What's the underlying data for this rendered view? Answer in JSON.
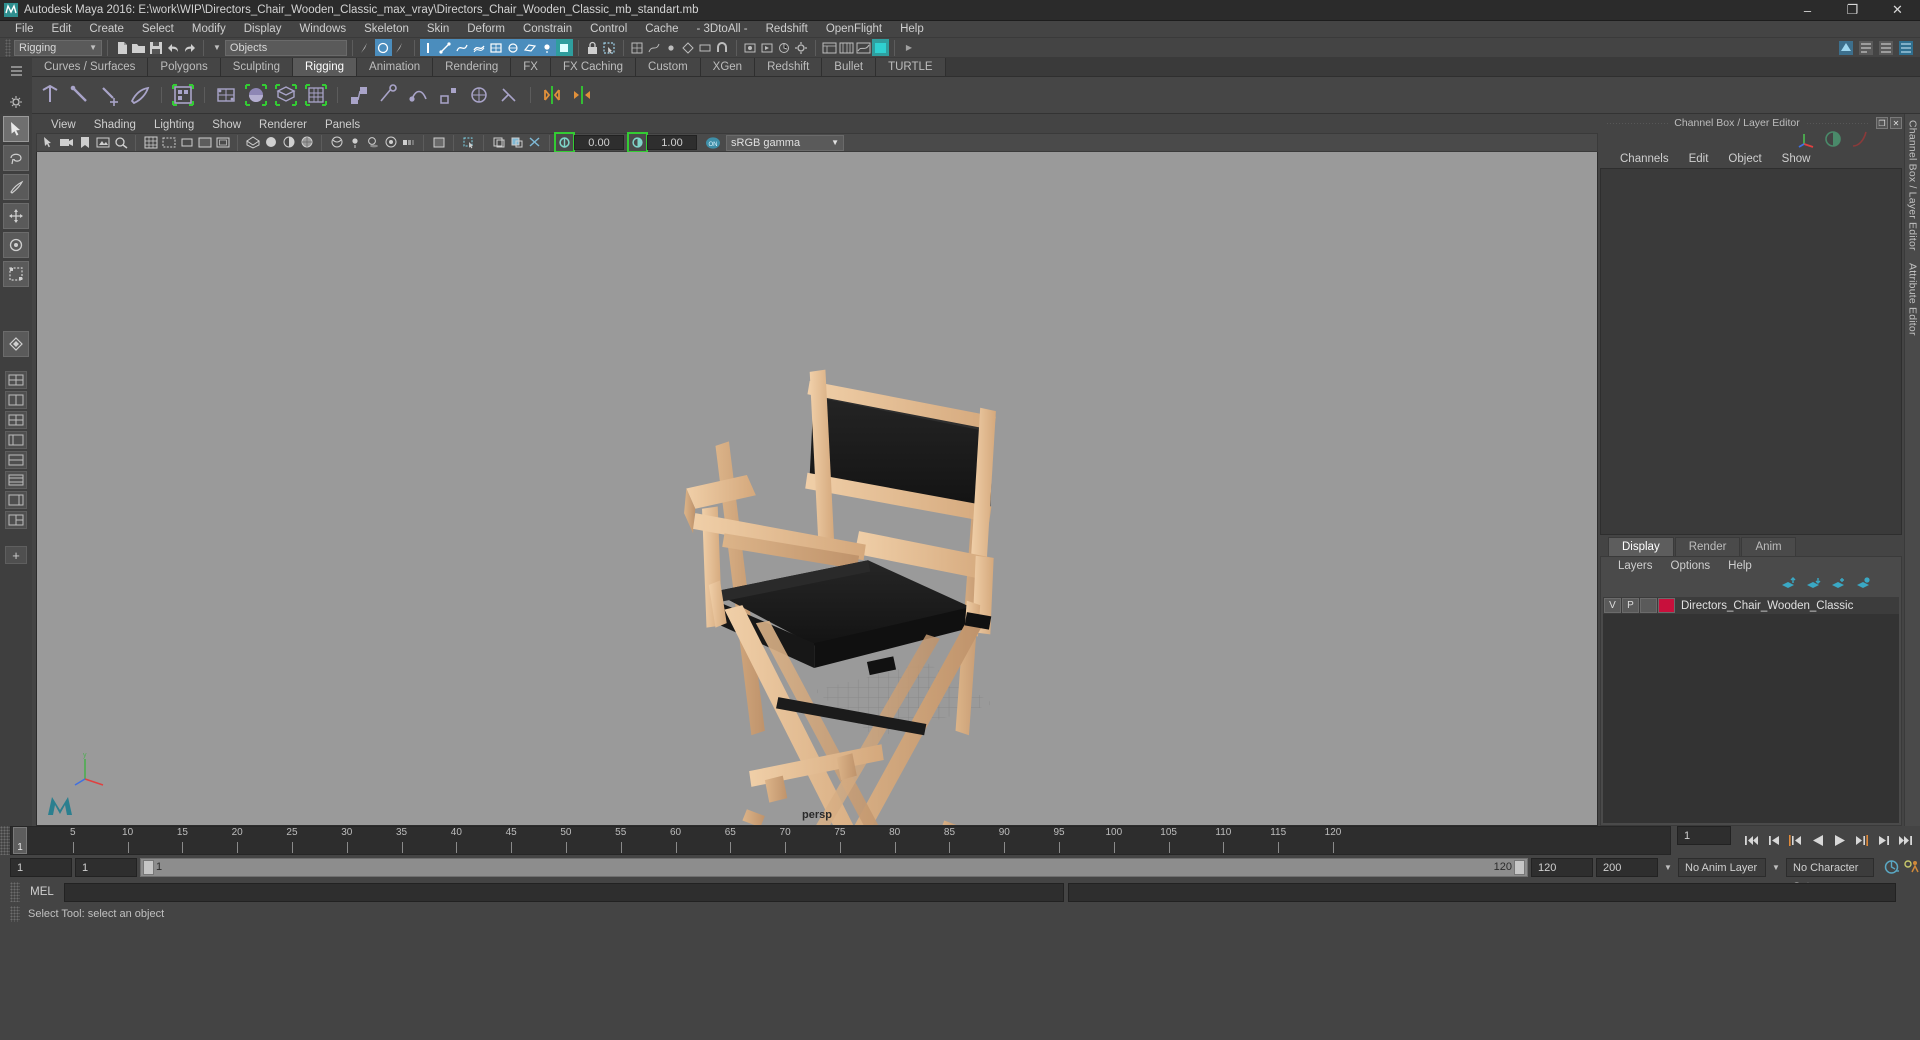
{
  "window": {
    "title": "Autodesk Maya 2016: E:\\work\\WIP\\Directors_Chair_Wooden_Classic_max_vray\\Directors_Chair_Wooden_Classic_mb_standart.mb",
    "minimize": "–",
    "maximize": "❐",
    "close": "✕"
  },
  "menubar": {
    "items": [
      "File",
      "Edit",
      "Create",
      "Select",
      "Modify",
      "Display",
      "Windows",
      "Skeleton",
      "Skin",
      "Deform",
      "Constrain",
      "Control",
      "Cache",
      "- 3DtoAll -",
      "Redshift",
      "OpenFlight",
      "Help"
    ]
  },
  "statusbar": {
    "menuset": "Rigging",
    "selection_mask": "Objects"
  },
  "shelf": {
    "tabs": [
      "Curves / Surfaces",
      "Polygons",
      "Sculpting",
      "Rigging",
      "Animation",
      "Rendering",
      "FX",
      "FX Caching",
      "Custom",
      "XGen",
      "Redshift",
      "Bullet",
      "TURTLE"
    ],
    "active_tab": "Rigging"
  },
  "viewport": {
    "menus": [
      "View",
      "Shading",
      "Lighting",
      "Show",
      "Renderer",
      "Panels"
    ],
    "exposure": "0.00",
    "gamma": "1.00",
    "color_profile": "sRGB gamma",
    "camera_label": "persp",
    "axis_label": "y"
  },
  "channelbox": {
    "panel_title": "Channel Box / Layer Editor",
    "menus": [
      "Channels",
      "Edit",
      "Object",
      "Show"
    ],
    "vertical_labels": [
      "Channel Box / Layer Editor",
      "Attribute Editor"
    ]
  },
  "layereditor": {
    "tabs": [
      "Display",
      "Render",
      "Anim"
    ],
    "active_tab": "Display",
    "menus": [
      "Layers",
      "Options",
      "Help"
    ],
    "columns": [
      "V",
      "P"
    ],
    "layers": [
      {
        "visible": "V",
        "playback": "P",
        "color": "#c8103c",
        "name": "Directors_Chair_Wooden_Classic"
      }
    ]
  },
  "timeline": {
    "ticks": [
      5,
      10,
      15,
      20,
      25,
      30,
      35,
      40,
      45,
      50,
      55,
      60,
      65,
      70,
      75,
      80,
      85,
      90,
      95,
      100,
      105,
      110,
      115,
      120
    ],
    "start": 1,
    "end": 120,
    "current_frame": "1",
    "current_marker": "1",
    "range_start": "1",
    "range_end": "1",
    "range_bar_start": "1",
    "range_bar_end": "120",
    "playback_end": "120",
    "anim_end": "200",
    "anim_layer": "No Anim Layer",
    "character_set": "No Character Set"
  },
  "commandline": {
    "mel_label": "MEL",
    "mel_value": "",
    "status_text": "Select Tool: select an object"
  },
  "colors": {
    "titlebar": "#2b2b2b",
    "chrome": "#444444",
    "viewport_bg": "#9a9a9a",
    "accent_blue": "#4b8dbd",
    "accent_green": "#33cc33",
    "layer_swatch": "#c8103c",
    "wood": "#e8c49a",
    "fabric": "#1c1c1c"
  }
}
